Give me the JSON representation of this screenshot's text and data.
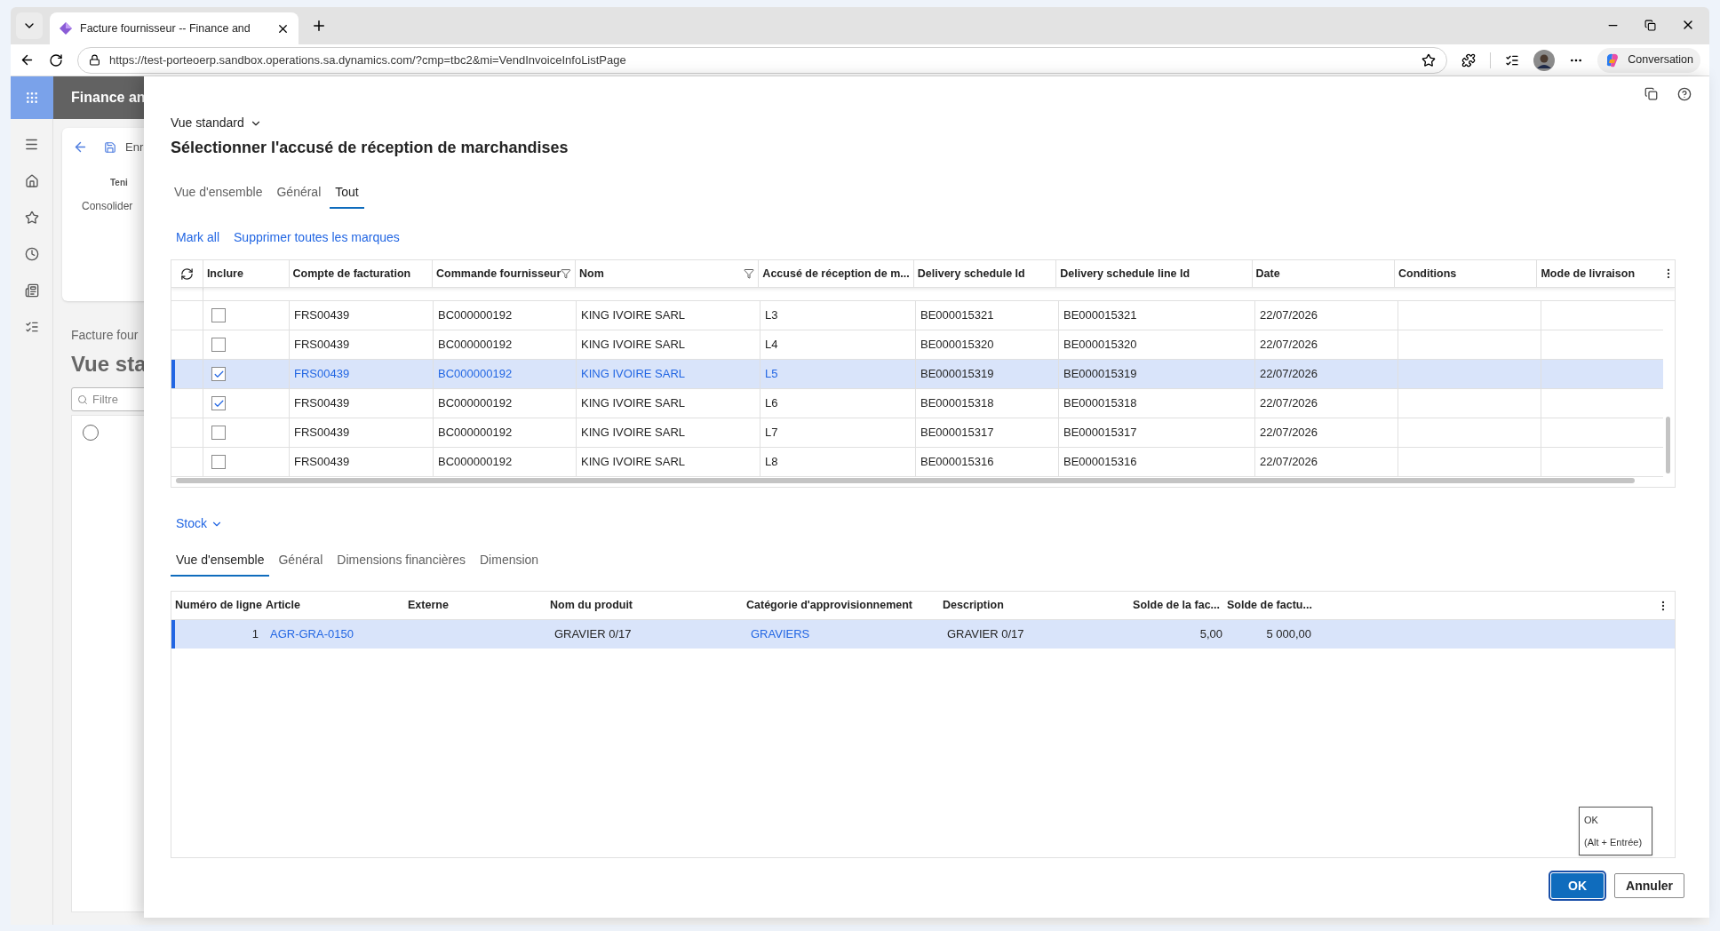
{
  "browser": {
    "tab_title": "Facture fournisseur -- Finance and",
    "url": "https://test-porteoerp.sandbox.operations.sa.dynamics.com/?cmp=tbc2&mi=VendInvoiceInfoListPage",
    "copilot_label": "Conversation"
  },
  "app": {
    "title": "Finance an"
  },
  "background_page": {
    "toolbar_item": "Enr",
    "group_label": "Teni",
    "action": "Consolider",
    "breadcrumb": "Facture four",
    "heading": "Vue sta",
    "filter_placeholder": "Filtre",
    "select_all_checked": false
  },
  "dialog": {
    "view_selector": "Vue standard",
    "title": "Sélectionner l'accusé de réception de marchandises",
    "tabs": [
      {
        "label": "Vue d'ensemble",
        "selected": false
      },
      {
        "label": "Général",
        "selected": false
      },
      {
        "label": "Tout",
        "selected": true
      }
    ],
    "actions": [
      "Mark all",
      "Supprimer toutes les marques"
    ],
    "grid": {
      "columns": [
        {
          "label": "Inclure",
          "filtered": false
        },
        {
          "label": "Compte de facturation",
          "filtered": false,
          "link": true
        },
        {
          "label": "Commande fournisseur",
          "filtered": true,
          "link": true
        },
        {
          "label": "Nom",
          "filtered": true,
          "link": true
        },
        {
          "label": "Accusé de réception de m...",
          "filtered": false,
          "link": true
        },
        {
          "label": "Delivery schedule Id",
          "filtered": false,
          "link": false
        },
        {
          "label": "Delivery schedule line Id",
          "filtered": false,
          "link": false
        },
        {
          "label": "Date",
          "filtered": false,
          "link": false
        },
        {
          "label": "Conditions",
          "filtered": false
        },
        {
          "label": "Mode de livraison",
          "filtered": false
        }
      ],
      "rows": [
        {
          "included": false,
          "selected": false,
          "cells": [
            "",
            "FRS00439",
            "BC000000192",
            "KING IVOIRE SARL",
            "L3",
            "BE000015321",
            "BE000015321",
            "22/07/2026"
          ]
        },
        {
          "included": false,
          "selected": false,
          "cells": [
            "",
            "FRS00439",
            "BC000000192",
            "KING IVOIRE SARL",
            "L4",
            "BE000015320",
            "BE000015320",
            "22/07/2026"
          ]
        },
        {
          "included": true,
          "selected": true,
          "cells": [
            "",
            "FRS00439",
            "BC000000192",
            "KING IVOIRE SARL",
            "L5",
            "BE000015319",
            "BE000015319",
            "22/07/2026"
          ]
        },
        {
          "included": true,
          "selected": false,
          "cells": [
            "",
            "FRS00439",
            "BC000000192",
            "KING IVOIRE SARL",
            "L6",
            "BE000015318",
            "BE000015318",
            "22/07/2026"
          ]
        },
        {
          "included": false,
          "selected": false,
          "cells": [
            "",
            "FRS00439",
            "BC000000192",
            "KING IVOIRE SARL",
            "L7",
            "BE000015317",
            "BE000015317",
            "22/07/2026"
          ]
        },
        {
          "included": false,
          "selected": false,
          "cells": [
            "",
            "FRS00439",
            "BC000000192",
            "KING IVOIRE SARL",
            "L8",
            "BE000015316",
            "BE000015316",
            "22/07/2026"
          ]
        }
      ]
    },
    "section": "Stock",
    "lower_tabs": [
      {
        "label": "Vue d'ensemble",
        "selected": true
      },
      {
        "label": "Général",
        "selected": false
      },
      {
        "label": "Dimensions financières",
        "selected": false
      },
      {
        "label": "Dimension",
        "selected": false
      }
    ],
    "lines_grid": {
      "columns": [
        {
          "label": "Numéro de ligne",
          "kind": "number",
          "link": false
        },
        {
          "label": "Article",
          "kind": "text",
          "link": true
        },
        {
          "label": "Externe",
          "kind": "text"
        },
        {
          "label": "Nom du produit",
          "kind": "text",
          "link": false
        },
        {
          "label": "Catégorie d'approvisionnement",
          "kind": "text",
          "link": true
        },
        {
          "label": "Description",
          "kind": "text",
          "link": false
        },
        {
          "label": "Solde de la fac...",
          "kind": "number",
          "link": false
        },
        {
          "label": "Solde de factu...",
          "kind": "number",
          "link": false
        }
      ],
      "rows": [
        {
          "selected": true,
          "cells": [
            "1",
            "AGR-GRA-0150",
            "",
            "GRAVIER 0/17",
            "GRAVIERS",
            "GRAVIER 0/17",
            "5,00",
            "5 000,00"
          ]
        }
      ]
    },
    "tooltip": {
      "title": "OK",
      "shortcut": "(Alt + Entrée)"
    },
    "buttons": [
      {
        "label": "OK",
        "kind": "primary"
      },
      {
        "label": "Annuler",
        "kind": "secondary"
      }
    ]
  }
}
